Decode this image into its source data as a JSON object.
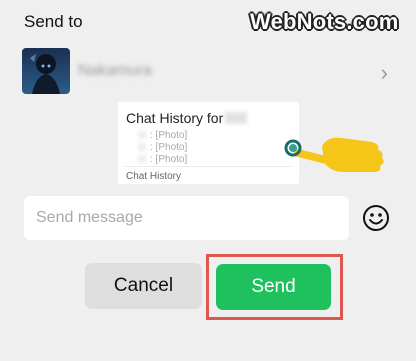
{
  "header": {
    "title": "Send to",
    "brand": "WebNots.com"
  },
  "recipient": {
    "name": "Nakamura",
    "avatar_icon": "anime-avatar-icon",
    "chevron_icon": "chevron-right-icon"
  },
  "card": {
    "title": "Chat History for",
    "lines": [
      ": [Photo]",
      ": [Photo]",
      ": [Photo]"
    ],
    "footer": "Chat History"
  },
  "message": {
    "placeholder": "Send message",
    "emoji_icon": "emoji-icon"
  },
  "buttons": {
    "cancel": "Cancel",
    "send": "Send"
  },
  "colors": {
    "send": "#1fc15f",
    "highlight": "#e0574f",
    "background": "#efefef"
  }
}
